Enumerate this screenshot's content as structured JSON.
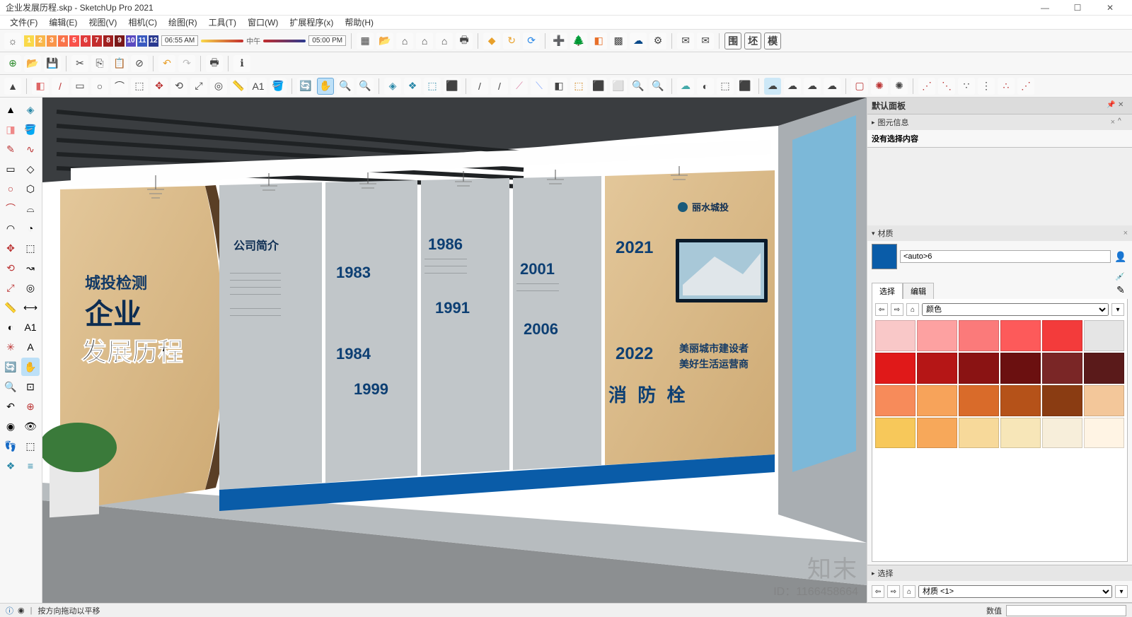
{
  "window": {
    "title": "企业发展历程.skp - SketchUp Pro 2021",
    "min": "—",
    "max": "☐",
    "close": "✕"
  },
  "menu": [
    "文件(F)",
    "编辑(E)",
    "视图(V)",
    "相机(C)",
    "绘图(R)",
    "工具(T)",
    "窗口(W)",
    "扩展程序(x)",
    "帮助(H)"
  ],
  "shadow": {
    "nums": [
      1,
      2,
      3,
      4,
      5,
      6,
      7,
      8,
      9,
      10,
      11,
      12
    ],
    "time1": "06:55 AM",
    "noon": "中午",
    "time2": "05:00 PM"
  },
  "statusbar": {
    "hint": "按方向拖动以平移",
    "measure_label": "数值"
  },
  "tray": {
    "default_panel": "默认面板",
    "entity_info": "图元信息",
    "no_selection": "没有选择内容",
    "materials": "材质",
    "material_name": "<auto>6",
    "tab_select": "选择",
    "tab_edit": "编辑",
    "dropdown_colors": "颜色",
    "selection": "选择",
    "selection_dd": "材质 <1>"
  },
  "colors": [
    "#f9c8c8",
    "#fda1a1",
    "#fb7a7a",
    "#fd5a5a",
    "#f33b3b",
    "#e5e5e5",
    "#e01919",
    "#b51616",
    "#8a1313",
    "#6b1010",
    "#7a2626",
    "#5a1a1a",
    "#f78b5a",
    "#f7a35a",
    "#d96b2a",
    "#b55219",
    "#8a3c12",
    "#f3c79a",
    "#f7c85a",
    "#f7a85a",
    "#f7d99a",
    "#f7e6b8",
    "#f7eeda",
    "#fff4e4"
  ],
  "scene": {
    "title_small": "城投检测",
    "title_big1": "企业",
    "title_big2": "发展历程",
    "intro": "公司简介",
    "years": [
      "1983",
      "1984",
      "1986",
      "1991",
      "1999",
      "2001",
      "2006",
      "2021",
      "2022"
    ],
    "fire": "消 防 栓",
    "brand": "丽水城投",
    "slogan1": "美丽城市建设者",
    "slogan2": "美好生活运营商"
  },
  "watermark": {
    "text": "知末",
    "id": "ID：1166458664"
  }
}
